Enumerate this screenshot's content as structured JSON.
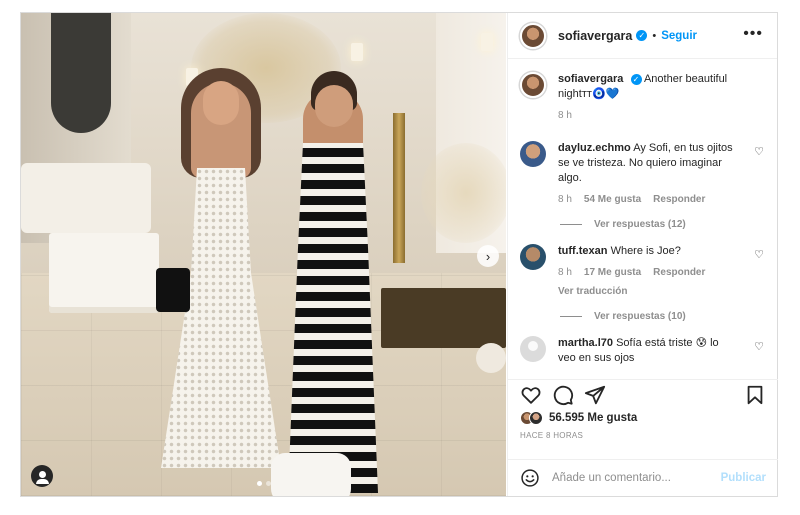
{
  "post": {
    "username": "sofiavergara",
    "separator": "•",
    "follow_label": "Seguir",
    "more_label": "•••",
    "caption": "Another beautiful nightтт",
    "caption_emoji": "🧿💙",
    "caption_time": "8 h"
  },
  "comments": [
    {
      "username": "dayluz.echmo",
      "text": "Ay Sofi, en tus ojitos se ve tristeza. No quiero imaginar algo.",
      "time": "8 h",
      "likes": "54 Me gusta",
      "reply": "Responder",
      "view_replies": "Ver respuestas (12)"
    },
    {
      "username": "tuff.texan",
      "text": "Where is Joe?",
      "time": "8 h",
      "likes": "17 Me gusta",
      "reply": "Responder",
      "translate": "Ver traducción",
      "view_replies": "Ver respuestas (10)"
    },
    {
      "username": "martha.l70",
      "text": "Sofía está triste 😰 lo veo en sus ojos"
    }
  ],
  "engagement": {
    "likes": "56.595 Me gusta",
    "time": "HACE 8 HORAS"
  },
  "comment_box": {
    "placeholder": "Añade un comentario...",
    "publish_label": "Publicar"
  },
  "icons": {
    "heart": "heart-icon",
    "comment": "comment-icon",
    "share": "share-icon",
    "bookmark": "bookmark-icon",
    "emoji": "emoji-icon",
    "verified": "verified-badge-icon",
    "next": "chevron-right-icon",
    "tags": "user-tag-icon"
  },
  "colors": {
    "accent": "#0095f6",
    "publish_disabled": "#b2dffc",
    "muted": "#8e8e8e"
  }
}
